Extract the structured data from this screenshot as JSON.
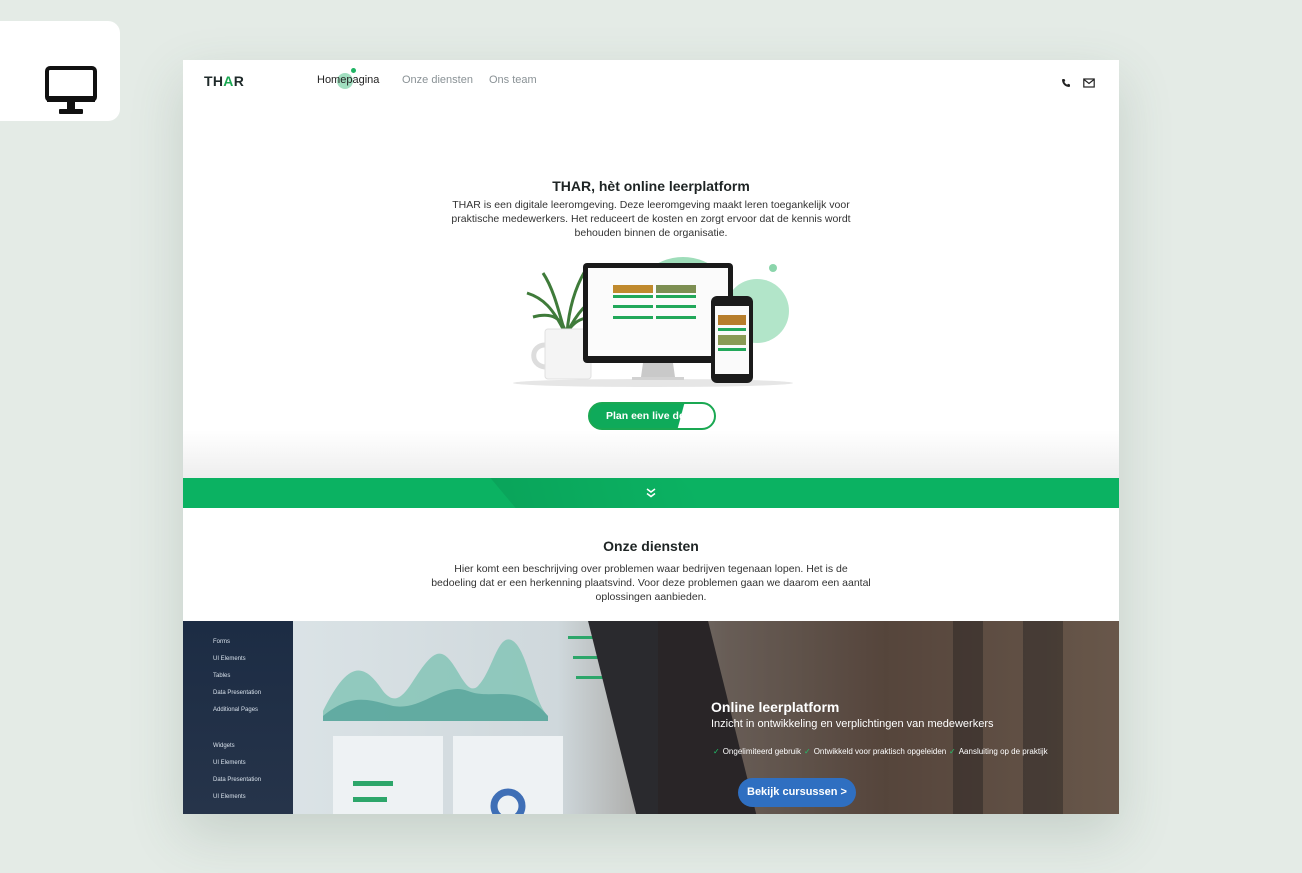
{
  "device_badge": {
    "icon": "desktop-monitor-icon"
  },
  "nav": {
    "logo_prefix": "TH",
    "logo_accent": "A",
    "logo_suffix": "R",
    "links": [
      "Homepagina",
      "Onze diensten",
      "Ons team"
    ],
    "active_link": "Homepagina",
    "icons": [
      "phone-icon",
      "mail-icon"
    ]
  },
  "hero": {
    "title": "THAR, hèt online leerplatform",
    "text": "THAR is een digitale leeromgeving. Deze leeromgeving maakt leren toegankelijk voor praktische medewerkers. Het reduceert de kosten en zorgt ervoor dat de kennis wordt behouden binnen de organisatie.",
    "cta_label": "Plan een live demo"
  },
  "divider": {
    "icon": "double-chevron-down-icon"
  },
  "services": {
    "title": "Onze diensten",
    "text": "Hier komt een beschrijving over problemen waar bedrijven tegenaan lopen. Het is de bedoeling dat er een herkenning plaatsvind. Voor deze problemen gaan we daarom een aantal oplossingen aanbieden."
  },
  "feature": {
    "title": "Online leerplatform",
    "subtitle": "Inzicht in ontwikkeling en verplichtingen van medewerkers",
    "bullets": [
      "Ongelimiteerd gebruik",
      "Ontwikkeld voor praktisch opgeleiden",
      "Aansluiting op de praktijk"
    ],
    "button_label": "Bekijk cursussen >",
    "dashboard_menu": [
      "Forms",
      "UI Elements",
      "Tables",
      "Data Presentation",
      "Additional Pages",
      "Widgets",
      "UI Elements",
      "Data Presentation",
      "UI Elements"
    ]
  },
  "colors": {
    "brand_green": "#0bb262",
    "button_blue": "#2f6fc1",
    "text_dark": "#1e2424"
  }
}
